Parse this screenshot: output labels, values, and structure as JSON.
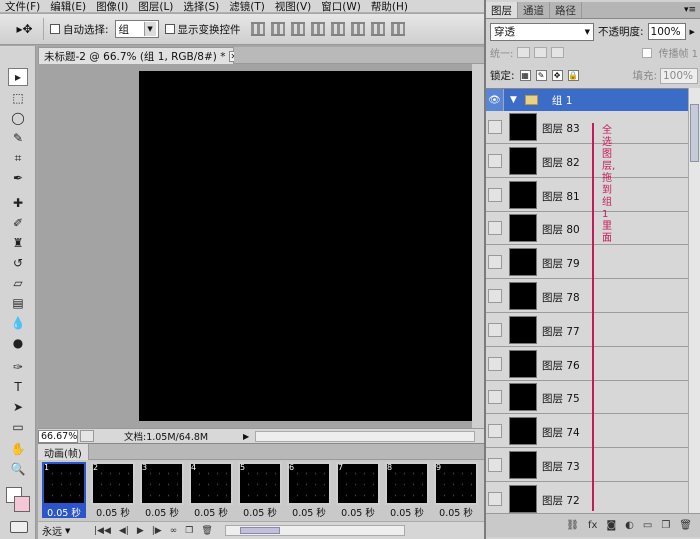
{
  "menu": [
    "文件(F)",
    "编辑(E)",
    "图像(I)",
    "图层(L)",
    "选择(S)",
    "滤镜(T)",
    "视图(V)",
    "窗口(W)",
    "帮助(H)"
  ],
  "options": {
    "tool_preset_icon": "move-tool-icon",
    "auto_select_label": "自动选择:",
    "auto_select_value": "组",
    "transform_controls_label": "显示变换控件"
  },
  "document": {
    "tab_title": "未标题-2 @ 66.7% (组 1, RGB/8#) *",
    "zoom": "66.67%",
    "doc_info": "文档:1.05M/64.8M"
  },
  "animation": {
    "tab_label": "动画(帧)",
    "loop_label": "永远",
    "frames": [
      {
        "num": "1",
        "delay": "0.05 秒"
      },
      {
        "num": "2",
        "delay": "0.05 秒"
      },
      {
        "num": "3",
        "delay": "0.05 秒"
      },
      {
        "num": "4",
        "delay": "0.05 秒"
      },
      {
        "num": "5",
        "delay": "0.05 秒"
      },
      {
        "num": "6",
        "delay": "0.05 秒"
      },
      {
        "num": "7",
        "delay": "0.05 秒"
      },
      {
        "num": "8",
        "delay": "0.05 秒"
      },
      {
        "num": "9",
        "delay": "0.05 秒"
      }
    ]
  },
  "layers_panel": {
    "tabs": [
      "图层",
      "通道",
      "路径"
    ],
    "blend_mode": "穿透",
    "opacity_label": "不透明度:",
    "opacity_value": "100%",
    "unify_label": "统一:",
    "propagate_label": "传播帧 1",
    "lock_label": "锁定:",
    "fill_label": "填充:",
    "fill_value": "100%",
    "group_name": "组 1",
    "layers": [
      "图层 83",
      "图层 82",
      "图层 81",
      "图层 80",
      "图层 79",
      "图层 78",
      "图层 77",
      "图层 76",
      "图层 75",
      "图层 74",
      "图层 73",
      "图层 72"
    ],
    "annotation": "全选图层,拖到组1里面"
  },
  "colors": {
    "selection_blue": "#3b6cc8",
    "annotation_red": "#c51a58",
    "background_swatch": "#f5c6d6"
  }
}
